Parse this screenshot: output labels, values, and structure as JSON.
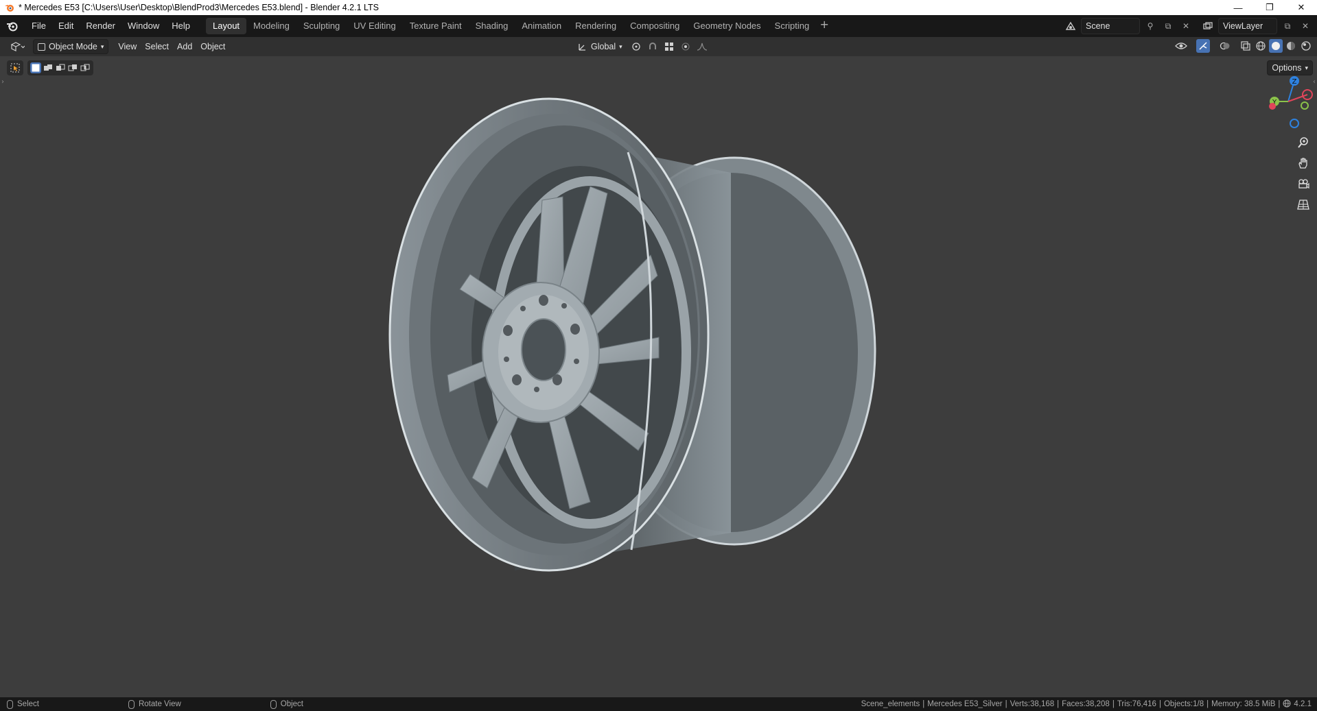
{
  "window": {
    "title": "* Mercedes E53 [C:\\Users\\User\\Desktop\\BlendProd3\\Mercedes E53.blend] - Blender 4.2.1 LTS",
    "minimize": "—",
    "maximize": "❐",
    "close": "✕"
  },
  "menu": [
    "File",
    "Edit",
    "Render",
    "Window",
    "Help"
  ],
  "workspaces": [
    "Layout",
    "Modeling",
    "Sculpting",
    "UV Editing",
    "Texture Paint",
    "Shading",
    "Animation",
    "Rendering",
    "Compositing",
    "Geometry Nodes",
    "Scripting"
  ],
  "active_workspace": "Layout",
  "scene": {
    "name": "Scene"
  },
  "view_layer": {
    "name": "ViewLayer"
  },
  "header": {
    "mode": "Object Mode",
    "view_menu": [
      "View",
      "Select",
      "Add",
      "Object"
    ],
    "transform_orientation": "Global"
  },
  "viewport": {
    "options_label": "Options",
    "gizmo_axes": [
      "X",
      "Y",
      "Z"
    ],
    "colors": {
      "x": "#e0455a",
      "y": "#8bc34a",
      "z": "#2e82e0",
      "background": "#3d3d3d"
    }
  },
  "status": {
    "hints": [
      {
        "label": "Select"
      },
      {
        "label": "Rotate View"
      },
      {
        "label": "Object"
      }
    ],
    "collection": "Scene_elements",
    "object": "Mercedes E53_Silver",
    "verts": "Verts:38,168",
    "faces": "Faces:38,208",
    "tris": "Tris:76,416",
    "objects": "Objects:1/8",
    "memory": "Memory: 38.5 MiB",
    "version": "4.2.1"
  }
}
